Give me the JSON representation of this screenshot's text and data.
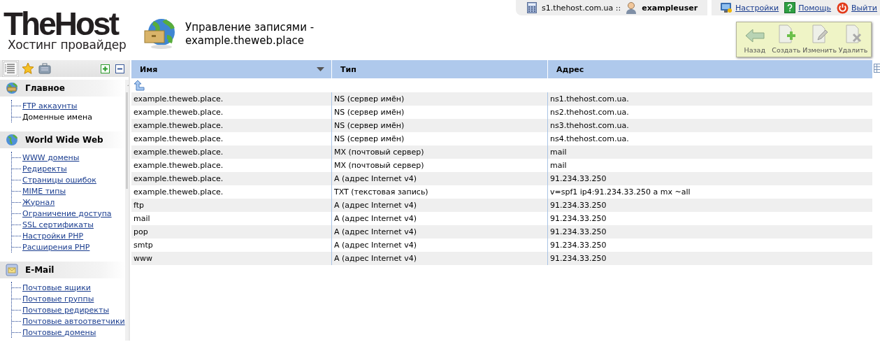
{
  "logo": {
    "name": "TheHost",
    "tagline": "Хостинг провайдер"
  },
  "page_title": "Управление записями - example.theweb.place",
  "server_bar": {
    "server": "s1.thehost.com.ua ::",
    "user": "exampleuser"
  },
  "top_links": [
    {
      "label": "Настройки",
      "kind": "settings"
    },
    {
      "label": "Помощь",
      "kind": "help"
    },
    {
      "label": "Выйти",
      "kind": "logout"
    }
  ],
  "toolbar": [
    {
      "label": "Назад",
      "kind": "back"
    },
    {
      "label": "Создать",
      "kind": "create"
    },
    {
      "label": "Изменить",
      "kind": "edit"
    },
    {
      "label": "Удалить",
      "kind": "delete"
    }
  ],
  "sidebar": {
    "tabs": [
      {
        "kind": "tree",
        "selected": true
      },
      {
        "kind": "favorites",
        "selected": false
      },
      {
        "kind": "tools",
        "selected": false
      }
    ],
    "sections": [
      {
        "title": "Главное",
        "kind": "main",
        "items": [
          {
            "label": "FTP аккаунты",
            "selected": false
          },
          {
            "label": "Доменные имена",
            "selected": true
          }
        ]
      },
      {
        "title": "World Wide Web",
        "kind": "www",
        "items": [
          {
            "label": "WWW домены",
            "selected": false
          },
          {
            "label": "Редиректы",
            "selected": false
          },
          {
            "label": "Страницы ошибок",
            "selected": false
          },
          {
            "label": "MIME типы",
            "selected": false
          },
          {
            "label": "Журнал",
            "selected": false
          },
          {
            "label": "Ограничение доступа",
            "selected": false
          },
          {
            "label": "SSL сертификаты",
            "selected": false
          },
          {
            "label": "Настройки PHP",
            "selected": false
          },
          {
            "label": "Расширения PHP",
            "selected": false
          }
        ]
      },
      {
        "title": "E-Mail",
        "kind": "mail",
        "items": [
          {
            "label": "Почтовые ящики",
            "selected": false
          },
          {
            "label": "Почтовые группы",
            "selected": false
          },
          {
            "label": "Почтовые редиректы",
            "selected": false
          },
          {
            "label": "Почтовые автоответчики",
            "selected": false
          },
          {
            "label": "Почтовые домены",
            "selected": false
          }
        ]
      }
    ]
  },
  "table": {
    "columns": [
      {
        "label": "Имя",
        "sorted": true
      },
      {
        "label": "Тип",
        "sorted": false
      },
      {
        "label": "Адрес",
        "sorted": false
      }
    ],
    "rows": [
      {
        "name": "example.theweb.place.",
        "type": "NS (сервер имён)",
        "address": "ns1.thehost.com.ua."
      },
      {
        "name": "example.theweb.place.",
        "type": "NS (сервер имён)",
        "address": "ns2.thehost.com.ua."
      },
      {
        "name": "example.theweb.place.",
        "type": "NS (сервер имён)",
        "address": "ns3.thehost.com.ua."
      },
      {
        "name": "example.theweb.place.",
        "type": "NS (сервер имён)",
        "address": "ns4.thehost.com.ua."
      },
      {
        "name": "example.theweb.place.",
        "type": "MX (почтовый сервер)",
        "address": "mail"
      },
      {
        "name": "example.theweb.place.",
        "type": "MX (почтовый сервер)",
        "address": "mail"
      },
      {
        "name": "example.theweb.place.",
        "type": "A (адрес Internet v4)",
        "address": "91.234.33.250"
      },
      {
        "name": "example.theweb.place.",
        "type": "TXT (текстовая запись)",
        "address": "v=spf1 ip4:91.234.33.250 a mx ~all"
      },
      {
        "name": "ftp",
        "type": "A (адрес Internet v4)",
        "address": "91.234.33.250"
      },
      {
        "name": "mail",
        "type": "A (адрес Internet v4)",
        "address": "91.234.33.250"
      },
      {
        "name": "pop",
        "type": "A (адрес Internet v4)",
        "address": "91.234.33.250"
      },
      {
        "name": "smtp",
        "type": "A (адрес Internet v4)",
        "address": "91.234.33.250"
      },
      {
        "name": "www",
        "type": "A (адрес Internet v4)",
        "address": "91.234.33.250"
      }
    ]
  }
}
